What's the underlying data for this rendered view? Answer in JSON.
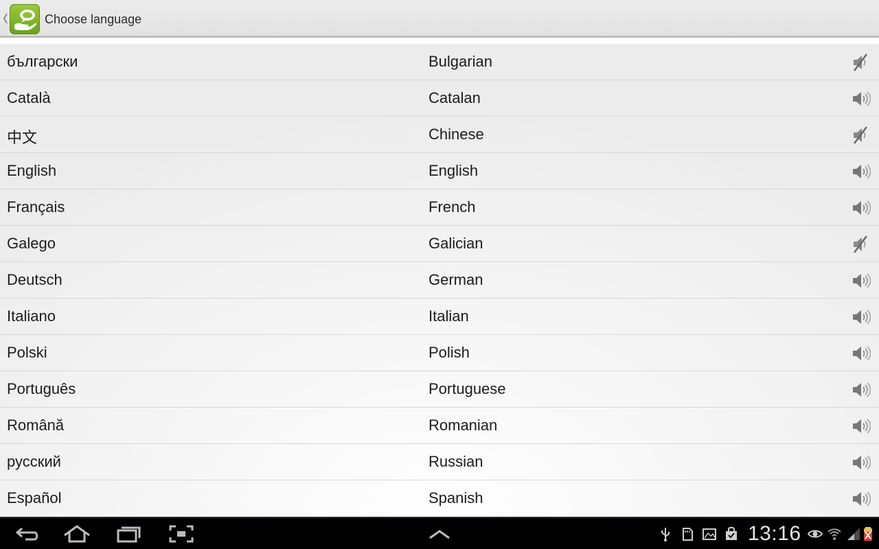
{
  "action_bar": {
    "title": "Choose language"
  },
  "languages": [
    {
      "native": "български",
      "english": "Bulgarian",
      "audio": "muted"
    },
    {
      "native": "Català",
      "english": "Catalan",
      "audio": "on"
    },
    {
      "native": "中文",
      "english": "Chinese",
      "audio": "muted"
    },
    {
      "native": "English",
      "english": "English",
      "audio": "on"
    },
    {
      "native": "Français",
      "english": "French",
      "audio": "on"
    },
    {
      "native": "Galego",
      "english": "Galician",
      "audio": "muted"
    },
    {
      "native": "Deutsch",
      "english": "German",
      "audio": "on"
    },
    {
      "native": "Italiano",
      "english": "Italian",
      "audio": "on"
    },
    {
      "native": "Polski",
      "english": "Polish",
      "audio": "on"
    },
    {
      "native": "Português",
      "english": "Portuguese",
      "audio": "on"
    },
    {
      "native": "Română",
      "english": "Romanian",
      "audio": "on"
    },
    {
      "native": "русский",
      "english": "Russian",
      "audio": "on"
    },
    {
      "native": "Español",
      "english": "Spanish",
      "audio": "on"
    }
  ],
  "system_bar": {
    "time": "13:16",
    "nav_icons": [
      "back-icon",
      "home-icon",
      "recent-apps-icon",
      "screenshot-icon",
      "menu-up-icon"
    ],
    "tray_icons": [
      "usb-icon",
      "sd-card-icon",
      "gallery-icon",
      "shopping-bag-icon",
      "eye-icon",
      "wifi-icon",
      "signal-icon",
      "battery-icon"
    ]
  },
  "colors": {
    "app_icon_green": "#7fb52b",
    "action_bar_bg": "#e6e6e6",
    "system_bar_bg": "#000000",
    "text": "#1c1c1c",
    "icon_gray": "#777777"
  }
}
